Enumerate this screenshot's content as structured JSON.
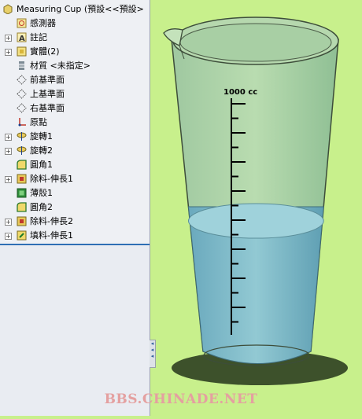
{
  "feature_tree": {
    "root_label": "Measuring Cup  (預設<<預設>",
    "items": [
      {
        "label": "感測器",
        "icon": "sensor-icon",
        "expandable": false
      },
      {
        "label": "註記",
        "icon": "annotation-icon",
        "expandable": true
      },
      {
        "label": "實體(2)",
        "icon": "solid-bodies-icon",
        "expandable": true
      },
      {
        "label": "材質 <未指定>",
        "icon": "material-icon",
        "expandable": false
      },
      {
        "label": "前基準面",
        "icon": "plane-icon",
        "expandable": false
      },
      {
        "label": "上基準面",
        "icon": "plane-icon",
        "expandable": false
      },
      {
        "label": "右基準面",
        "icon": "plane-icon",
        "expandable": false
      },
      {
        "label": "原點",
        "icon": "origin-icon",
        "expandable": false
      },
      {
        "label": "旋轉1",
        "icon": "revolve-icon",
        "expandable": true
      },
      {
        "label": "旋轉2",
        "icon": "revolve-icon",
        "expandable": true
      },
      {
        "label": "圓角1",
        "icon": "fillet-icon",
        "expandable": false
      },
      {
        "label": "除料-伸長1",
        "icon": "cut-extrude-icon",
        "expandable": true
      },
      {
        "label": "薄殼1",
        "icon": "shell-icon",
        "expandable": false
      },
      {
        "label": "圓角2",
        "icon": "fillet-icon",
        "expandable": false
      },
      {
        "label": "除料-伸長2",
        "icon": "cut-extrude-icon",
        "expandable": true
      },
      {
        "label": "填料-伸長1",
        "icon": "boss-extrude-icon",
        "expandable": true
      }
    ]
  },
  "viewport": {
    "scale_label": "1000 cc",
    "liquid_level": 0.47,
    "background_color": "#c8f08c"
  },
  "watermark": "BBS.CHINADE.NET"
}
